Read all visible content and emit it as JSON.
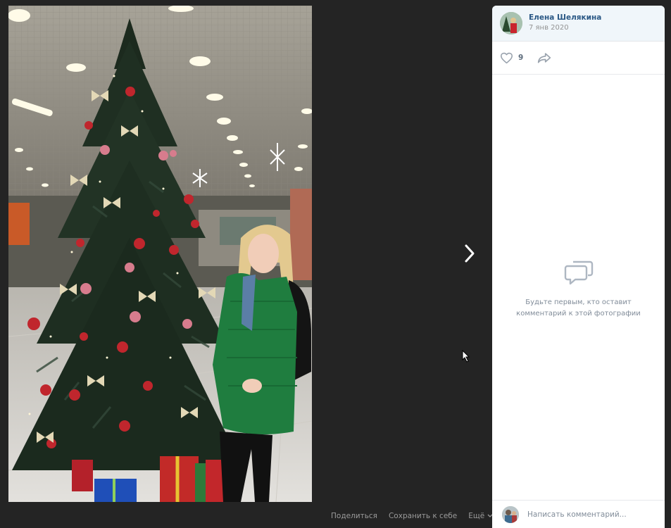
{
  "author": {
    "name": "Елена Шелякина",
    "date": "7 янв 2020"
  },
  "reactions": {
    "likes": "9"
  },
  "comments": {
    "empty_text": "Будьте первым, кто оставит комментарий к этой фотографии",
    "input_placeholder": "Написать комментарий..."
  },
  "photo_actions": {
    "share": "Поделиться",
    "save": "Сохранить к себе",
    "more": "Ещё"
  },
  "colors": {
    "background": "#242424",
    "panel": "#ffffff",
    "author_link": "#2a5885",
    "secondary_text": "#818c99",
    "icon": "#99a2ad"
  },
  "icons": [
    "chevron-right-icon",
    "heart-icon",
    "share-arrow-icon",
    "comment-bubble-icon",
    "chevron-down-icon",
    "mouse-pointer-icon"
  ]
}
